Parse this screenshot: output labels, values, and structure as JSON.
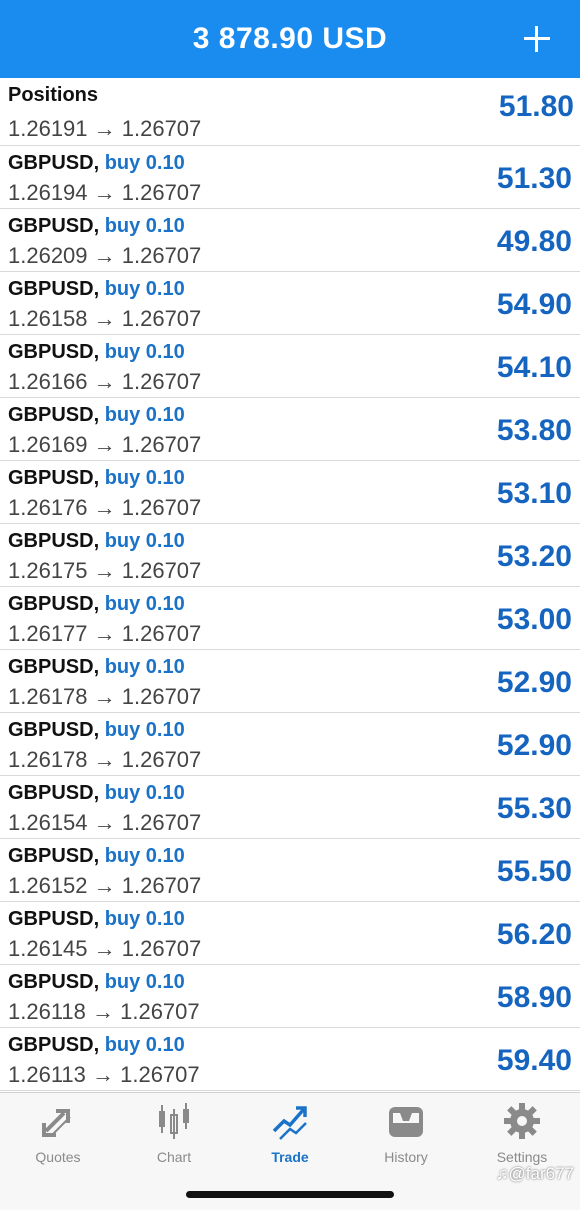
{
  "header": {
    "balance": "3 878.90 USD"
  },
  "section": {
    "title": "Positions"
  },
  "partial_position": {
    "prices": "1.26191 → 1.26707",
    "profit": "51.80"
  },
  "positions": [
    {
      "symbol": "GBPUSD,",
      "side": "buy 0.10",
      "prices": "1.26194 → 1.26707",
      "profit": "51.30"
    },
    {
      "symbol": "GBPUSD,",
      "side": "buy 0.10",
      "prices": "1.26209 → 1.26707",
      "profit": "49.80"
    },
    {
      "symbol": "GBPUSD,",
      "side": "buy 0.10",
      "prices": "1.26158 → 1.26707",
      "profit": "54.90"
    },
    {
      "symbol": "GBPUSD,",
      "side": "buy 0.10",
      "prices": "1.26166 → 1.26707",
      "profit": "54.10"
    },
    {
      "symbol": "GBPUSD,",
      "side": "buy 0.10",
      "prices": "1.26169 → 1.26707",
      "profit": "53.80"
    },
    {
      "symbol": "GBPUSD,",
      "side": "buy 0.10",
      "prices": "1.26176 → 1.26707",
      "profit": "53.10"
    },
    {
      "symbol": "GBPUSD,",
      "side": "buy 0.10",
      "prices": "1.26175 → 1.26707",
      "profit": "53.20"
    },
    {
      "symbol": "GBPUSD,",
      "side": "buy 0.10",
      "prices": "1.26177 → 1.26707",
      "profit": "53.00"
    },
    {
      "symbol": "GBPUSD,",
      "side": "buy 0.10",
      "prices": "1.26178 → 1.26707",
      "profit": "52.90"
    },
    {
      "symbol": "GBPUSD,",
      "side": "buy 0.10",
      "prices": "1.26178 → 1.26707",
      "profit": "52.90"
    },
    {
      "symbol": "GBPUSD,",
      "side": "buy 0.10",
      "prices": "1.26154 → 1.26707",
      "profit": "55.30"
    },
    {
      "symbol": "GBPUSD,",
      "side": "buy 0.10",
      "prices": "1.26152 → 1.26707",
      "profit": "55.50"
    },
    {
      "symbol": "GBPUSD,",
      "side": "buy 0.10",
      "prices": "1.26145 → 1.26707",
      "profit": "56.20"
    },
    {
      "symbol": "GBPUSD,",
      "side": "buy 0.10",
      "prices": "1.26118 → 1.26707",
      "profit": "58.90"
    },
    {
      "symbol": "GBPUSD,",
      "side": "buy 0.10",
      "prices": "1.26113 → 1.26707",
      "profit": "59.40"
    }
  ],
  "tabs": [
    {
      "label": "Quotes",
      "icon": "quotes-arrows-icon",
      "active": false
    },
    {
      "label": "Chart",
      "icon": "candlestick-chart-icon",
      "active": false
    },
    {
      "label": "Trade",
      "icon": "trade-trend-icon",
      "active": true
    },
    {
      "label": "History",
      "icon": "history-inbox-icon",
      "active": false
    },
    {
      "label": "Settings",
      "icon": "gear-icon",
      "active": false
    }
  ],
  "watermark": "♫@far677",
  "colors": {
    "header": "#1a8cf0",
    "side_text": "#1a73c8",
    "profit_text": "#1565c0",
    "active_tab": "#1a73c8",
    "inactive_tab": "#8a8a8a"
  }
}
